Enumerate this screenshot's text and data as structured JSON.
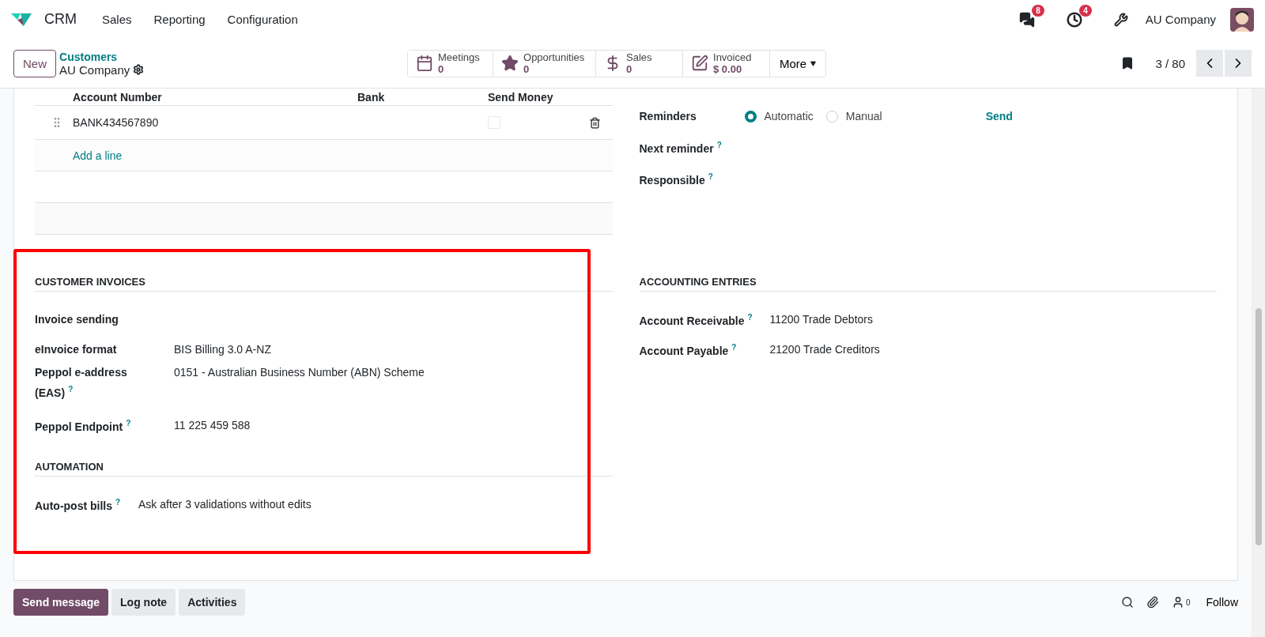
{
  "navbar": {
    "app_name": "CRM",
    "menus": [
      "Sales",
      "Reporting",
      "Configuration"
    ],
    "messages_count": "8",
    "activities_count": "4",
    "company": "AU Company"
  },
  "control_panel": {
    "new_button": "New",
    "breadcrumb_parent": "Customers",
    "breadcrumb_current": "AU Company",
    "smart_buttons": [
      {
        "kind": "calendar",
        "label": "Meetings",
        "value": "0"
      },
      {
        "kind": "star",
        "label": "Opportunities",
        "value": "0"
      },
      {
        "kind": "dollar",
        "label": "Sales",
        "value": "0"
      },
      {
        "kind": "edit",
        "label": "Invoiced",
        "value": "$ 0.00"
      }
    ],
    "more": "More",
    "pager": "3 / 80"
  },
  "bank_table": {
    "columns": [
      "Account Number",
      "Bank",
      "Send Money"
    ],
    "rows": [
      {
        "account_number": "BANK434567890",
        "send_money": false
      }
    ],
    "add_line": "Add a line"
  },
  "reminders": {
    "label": "Reminders",
    "options": [
      {
        "label": "Automatic",
        "selected": true
      },
      {
        "label": "Manual",
        "selected": false
      }
    ],
    "send": "Send",
    "fields": [
      {
        "label": "Next reminder",
        "help": "?"
      },
      {
        "label": "Responsible",
        "help": "?"
      }
    ]
  },
  "customer_invoices": {
    "title": "CUSTOMER INVOICES",
    "fields": [
      {
        "label": "Invoice sending"
      },
      {
        "label": "eInvoice format",
        "value": "BIS Billing 3.0 A-NZ"
      },
      {
        "label": "Peppol e-address (EAS)",
        "help": "?",
        "value": "0151 - Australian Business Number (ABN) Scheme"
      },
      {
        "label": "Peppol Endpoint",
        "help": "?",
        "value": "11 225 459 588"
      }
    ]
  },
  "automation": {
    "title": "AUTOMATION",
    "fields": [
      {
        "label": "Auto-post bills",
        "help": "?",
        "value": "Ask after 3 validations without edits"
      }
    ]
  },
  "accounting_entries": {
    "title": "ACCOUNTING ENTRIES",
    "fields": [
      {
        "label": "Account Receivable",
        "help": "?",
        "value": "11200 Trade Debtors"
      },
      {
        "label": "Account Payable",
        "help": "?",
        "value": "21200 Trade Creditors"
      }
    ]
  },
  "chatter": {
    "buttons": [
      {
        "label": "Send message",
        "selected": true
      },
      {
        "label": "Log note",
        "selected": false
      },
      {
        "label": "Activities",
        "selected": false
      }
    ],
    "followers_count": "0",
    "follow": "Follow"
  }
}
